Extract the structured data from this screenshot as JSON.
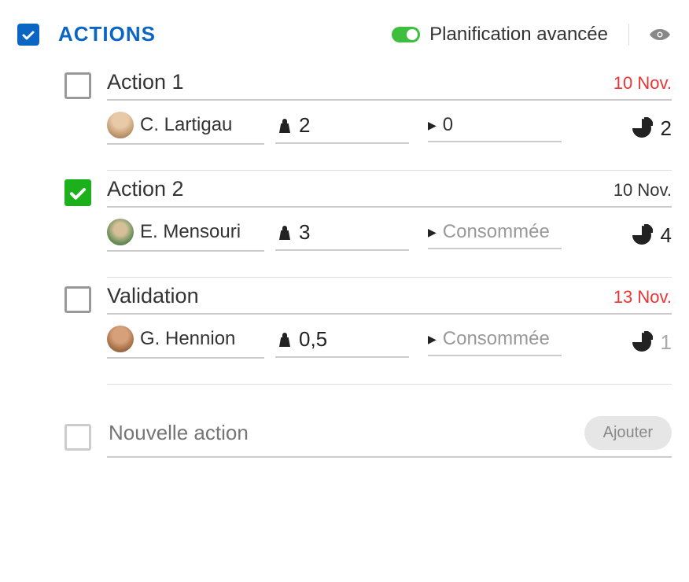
{
  "header": {
    "title": "ACTIONS",
    "toggle_label": "Planification avancée",
    "toggle_on": true
  },
  "actions": [
    {
      "checked": false,
      "title": "Action 1",
      "date": "10 Nov.",
      "overdue": true,
      "assignee": "C. Lartigau",
      "weight": "2",
      "consumed": "0",
      "consumed_is_placeholder": false,
      "chart": "2",
      "chart_placeholder": false
    },
    {
      "checked": true,
      "title": "Action 2",
      "date": "10 Nov.",
      "overdue": false,
      "assignee": "E. Mensouri",
      "weight": "3",
      "consumed": "Consommée",
      "consumed_is_placeholder": true,
      "chart": "4",
      "chart_placeholder": false
    },
    {
      "checked": false,
      "title": "Validation",
      "date": "13 Nov.",
      "overdue": true,
      "assignee": "G. Hennion",
      "weight": "0,5",
      "consumed": "Consommée",
      "consumed_is_placeholder": true,
      "chart": "1",
      "chart_placeholder": true
    }
  ],
  "new_action": {
    "placeholder": "Nouvelle action",
    "button": "Ajouter"
  }
}
